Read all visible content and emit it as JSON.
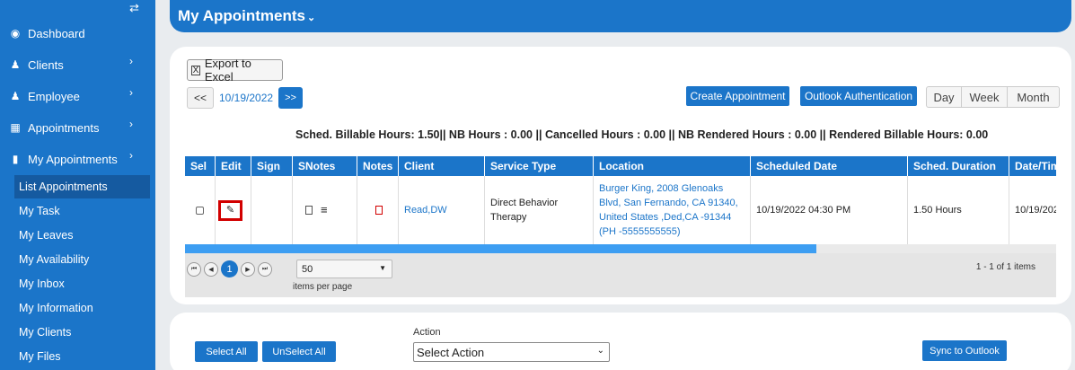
{
  "sidebar": {
    "toggle_icon": "⇄",
    "items": [
      {
        "icon": "dashboard-icon",
        "glyph": "◉",
        "label": "Dashboard"
      },
      {
        "icon": "user-icon",
        "glyph": "♟",
        "label": "Clients",
        "chevron": "›"
      },
      {
        "icon": "users-icon",
        "glyph": "♟",
        "label": "Employee",
        "chevron": "›"
      },
      {
        "icon": "calendar-icon",
        "glyph": "▦",
        "label": "Appointments",
        "chevron": "›"
      },
      {
        "icon": "book-icon",
        "glyph": "▮",
        "label": "My Appointments",
        "chevron": "›"
      }
    ],
    "sub_items": [
      "List Appointments",
      "My Task",
      "My Leaves",
      "My Availability",
      "My Inbox",
      "My Information",
      "My Clients",
      "My Files"
    ]
  },
  "header": {
    "title": "My Appointments",
    "caret": "⌄"
  },
  "toolbar": {
    "export_label": "Export to Excel",
    "export_icon_glyph": "X",
    "prev_label": "<<",
    "date": "10/19/2022",
    "next_label": ">>",
    "create_label": "Create Appointment",
    "outlook_label": "Outlook Authentication",
    "views": [
      "Day",
      "Week",
      "Month"
    ]
  },
  "summary": "Sched. Billable Hours: 1.50|| NB Hours : 0.00 || Cancelled Hours : 0.00 || NB Rendered Hours : 0.00 || Rendered Billable Hours: 0.00",
  "grid": {
    "columns": [
      "Sel",
      "Edit",
      "Sign",
      "SNotes",
      "Notes",
      "Client",
      "Service Type",
      "Location",
      "Scheduled Date",
      "Sched. Duration",
      "Date/Tim"
    ],
    "row": {
      "edit_glyph": "✎",
      "snotes_menu_glyph": "≡",
      "client": "Read,DW",
      "service_type": "Direct Behavior Therapy",
      "location": "Burger King, 2008 Glenoaks Blvd, San Fernando, CA 91340, United States ,Ded,CA -91344 (PH -5555555555)",
      "scheduled_date": "10/19/2022 04:30 PM",
      "duration": "1.50 Hours",
      "date_time": "10/19/202"
    },
    "scroll_fraction": 0.725
  },
  "pager": {
    "first": "⏮",
    "prev": "◀",
    "current": "1",
    "next": "▶",
    "last": "⏭",
    "page_size": "50",
    "page_size_caret": "▼",
    "items_per_page_label": "items per page",
    "items_info": "1 - 1 of 1 items"
  },
  "bottom": {
    "select_all": "Select All",
    "unselect_all": "UnSelect All",
    "action_label": "Action",
    "action_value": "Select Action",
    "action_caret": "⌄",
    "sync_label": "Sync to Outlook"
  },
  "colors": {
    "primary": "#1b75c9",
    "highlight_box": "#d20000",
    "active_nav": "#155aa0"
  }
}
